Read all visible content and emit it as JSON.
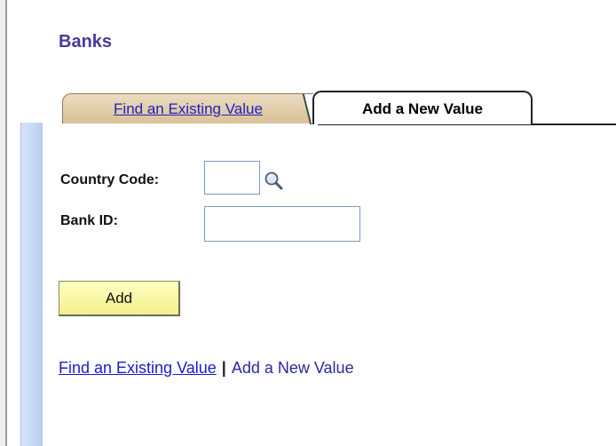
{
  "page": {
    "title": "Banks"
  },
  "tabs": [
    {
      "label": "Find an Existing Value",
      "selected": false
    },
    {
      "label": "Add a New Value",
      "selected": true
    }
  ],
  "form": {
    "country_code": {
      "label": "Country Code:",
      "value": ""
    },
    "bank_id": {
      "label": "Bank ID:",
      "value": ""
    },
    "lookup_icon": "magnifier-icon",
    "add_button": "Add"
  },
  "links": {
    "find": "Find an Existing Value",
    "separator": "|",
    "add": "Add a New Value"
  },
  "colors": {
    "title": "#4b3a9a",
    "inactive_tab": "#d9c098",
    "add_button": "#f4ef8c",
    "link": "#1a1ad0"
  }
}
